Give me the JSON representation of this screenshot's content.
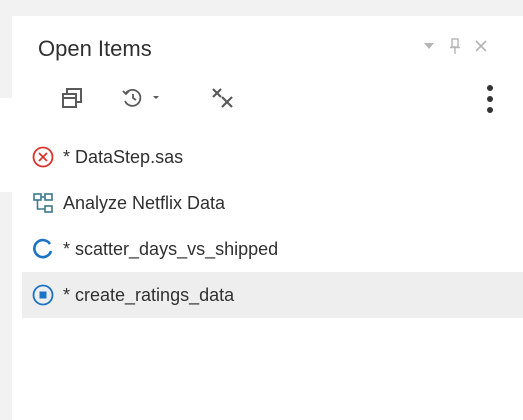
{
  "panel": {
    "title": "Open Items"
  },
  "header_controls": [
    {
      "name": "menu-dropdown-icon",
      "glyph": "▼"
    },
    {
      "name": "pin-icon"
    },
    {
      "name": "close-icon",
      "glyph": "✕"
    }
  ],
  "toolbar": {
    "buttons": [
      {
        "name": "restore-window-icon"
      },
      {
        "name": "history-icon"
      },
      {
        "name": "close-all-icon"
      },
      {
        "name": "more-options-icon"
      }
    ]
  },
  "items": [
    {
      "modified": "*",
      "label": "DataStep.sas",
      "icon": "error-icon",
      "icon_color": "#d9342b",
      "selected": false
    },
    {
      "modified": "",
      "label": "Analyze Netflix Data",
      "icon": "flow-icon",
      "icon_color": "#3a7a8c",
      "selected": false
    },
    {
      "modified": "*",
      "label": "scatter_days_vs_shipped",
      "icon": "running-icon",
      "icon_color": "#1a73c4",
      "selected": false
    },
    {
      "modified": "*",
      "label": "create_ratings_data",
      "icon": "stop-icon",
      "icon_color": "#1a73c4",
      "selected": true
    }
  ]
}
